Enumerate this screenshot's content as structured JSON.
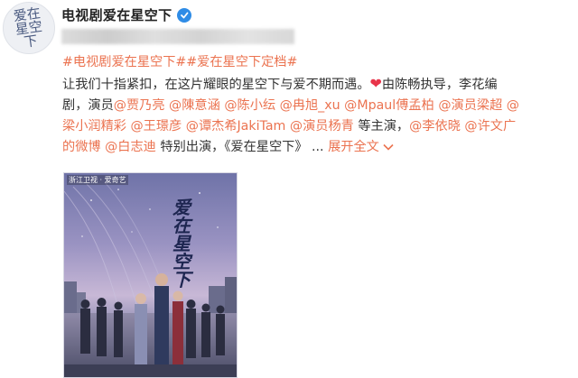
{
  "author": {
    "name": "电视剧爱在星空下",
    "avatar_text": "爱在星空下",
    "verified_icon": "verified-badge-icon"
  },
  "post": {
    "hashtags": [
      "#电视剧爱在星空下#",
      "#爱在星空下定档#"
    ],
    "line2_text": "让我们十指紧扣，在这片耀眼的星空下与爱不期而遇。",
    "heart": "❤",
    "line2_tail": "由陈畅执导，李花编",
    "line3_prefix": "剧，演员",
    "mentions_a": [
      "@贾乃亮",
      "@陳意涵",
      "@陈小纭",
      "@冉旭_xu",
      "@Mpaul傅孟柏",
      "@演员梁超",
      "@"
    ],
    "mentions_b": [
      "梁小润精彩",
      "@王璟彦",
      "@谭杰希JakiTam",
      "@演员杨青"
    ],
    "cast_suffix": "等主演，",
    "mentions_c": [
      "@李依晓",
      "@许文广"
    ],
    "mentions_d": [
      "的微博",
      "@白志迪"
    ],
    "special_text": "特别出演，《爱在星空下》 ...",
    "expand_label": "展开全文",
    "accent_color": "#eb7350"
  },
  "poster": {
    "badge": "浙江卫视 · 爱奇艺",
    "title": "爱在星空下"
  }
}
